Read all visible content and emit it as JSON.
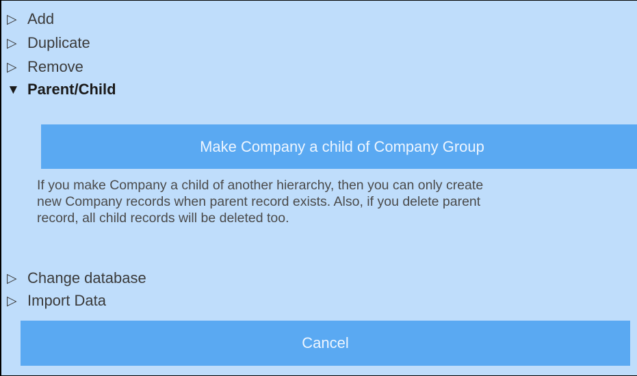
{
  "menu": {
    "add": {
      "icon": "triangle-right-outline-icon",
      "label": "Add"
    },
    "duplicate": {
      "icon": "triangle-right-outline-icon",
      "label": "Duplicate"
    },
    "remove": {
      "icon": "triangle-right-outline-icon",
      "label": "Remove"
    },
    "parent_child": {
      "icon": "triangle-down-filled-icon",
      "label": "Parent/Child"
    },
    "change_database": {
      "icon": "triangle-right-outline-icon",
      "label": "Change database"
    },
    "import_data": {
      "icon": "triangle-right-outline-icon",
      "label": "Import Data"
    }
  },
  "parent_child_section": {
    "make_child_label": "Make Company a child of Company Group",
    "info_line1": "If you make Company a child of another hierarchy, then you can only create",
    "info_line2": "new Company records when parent record exists. Also, if you delete parent",
    "info_line3": "record, all child records will be deleted too."
  },
  "footer": {
    "cancel_label": "Cancel"
  },
  "colors": {
    "panel_background": "#bfddfb",
    "button_background": "#5aa9f2",
    "button_text": "#eef6ff",
    "text": "#3a3a3a"
  }
}
